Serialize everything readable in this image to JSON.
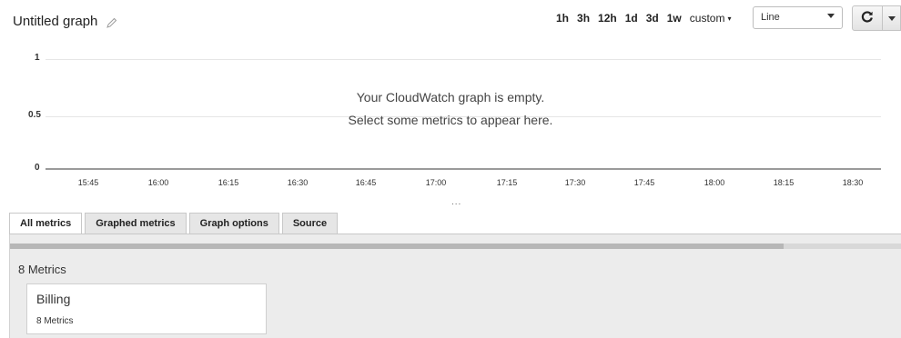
{
  "graph": {
    "title": "Untitled graph",
    "edit_icon": "pencil-icon",
    "empty_line1": "Your CloudWatch graph is empty.",
    "empty_line2": "Select some metrics to appear here.",
    "ellipsis": "...",
    "y_ticks": [
      "1",
      "0.5",
      "0"
    ],
    "x_ticks": [
      "15:45",
      "16:00",
      "16:15",
      "16:30",
      "16:45",
      "17:00",
      "17:15",
      "17:30",
      "17:45",
      "18:00",
      "18:15",
      "18:30"
    ]
  },
  "toolbar": {
    "ranges": [
      "1h",
      "3h",
      "12h",
      "1d",
      "3d",
      "1w"
    ],
    "custom_label": "custom",
    "chart_type": "Line",
    "refresh_icon": "refresh-icon",
    "menu_icon": "chevron-down-icon"
  },
  "tabs": [
    "All metrics",
    "Graphed metrics",
    "Graph options",
    "Source"
  ],
  "active_tab": "All metrics",
  "metrics": {
    "count_label": "8 Metrics",
    "namespaces": [
      {
        "name": "Billing",
        "count": "8 Metrics"
      }
    ]
  }
}
